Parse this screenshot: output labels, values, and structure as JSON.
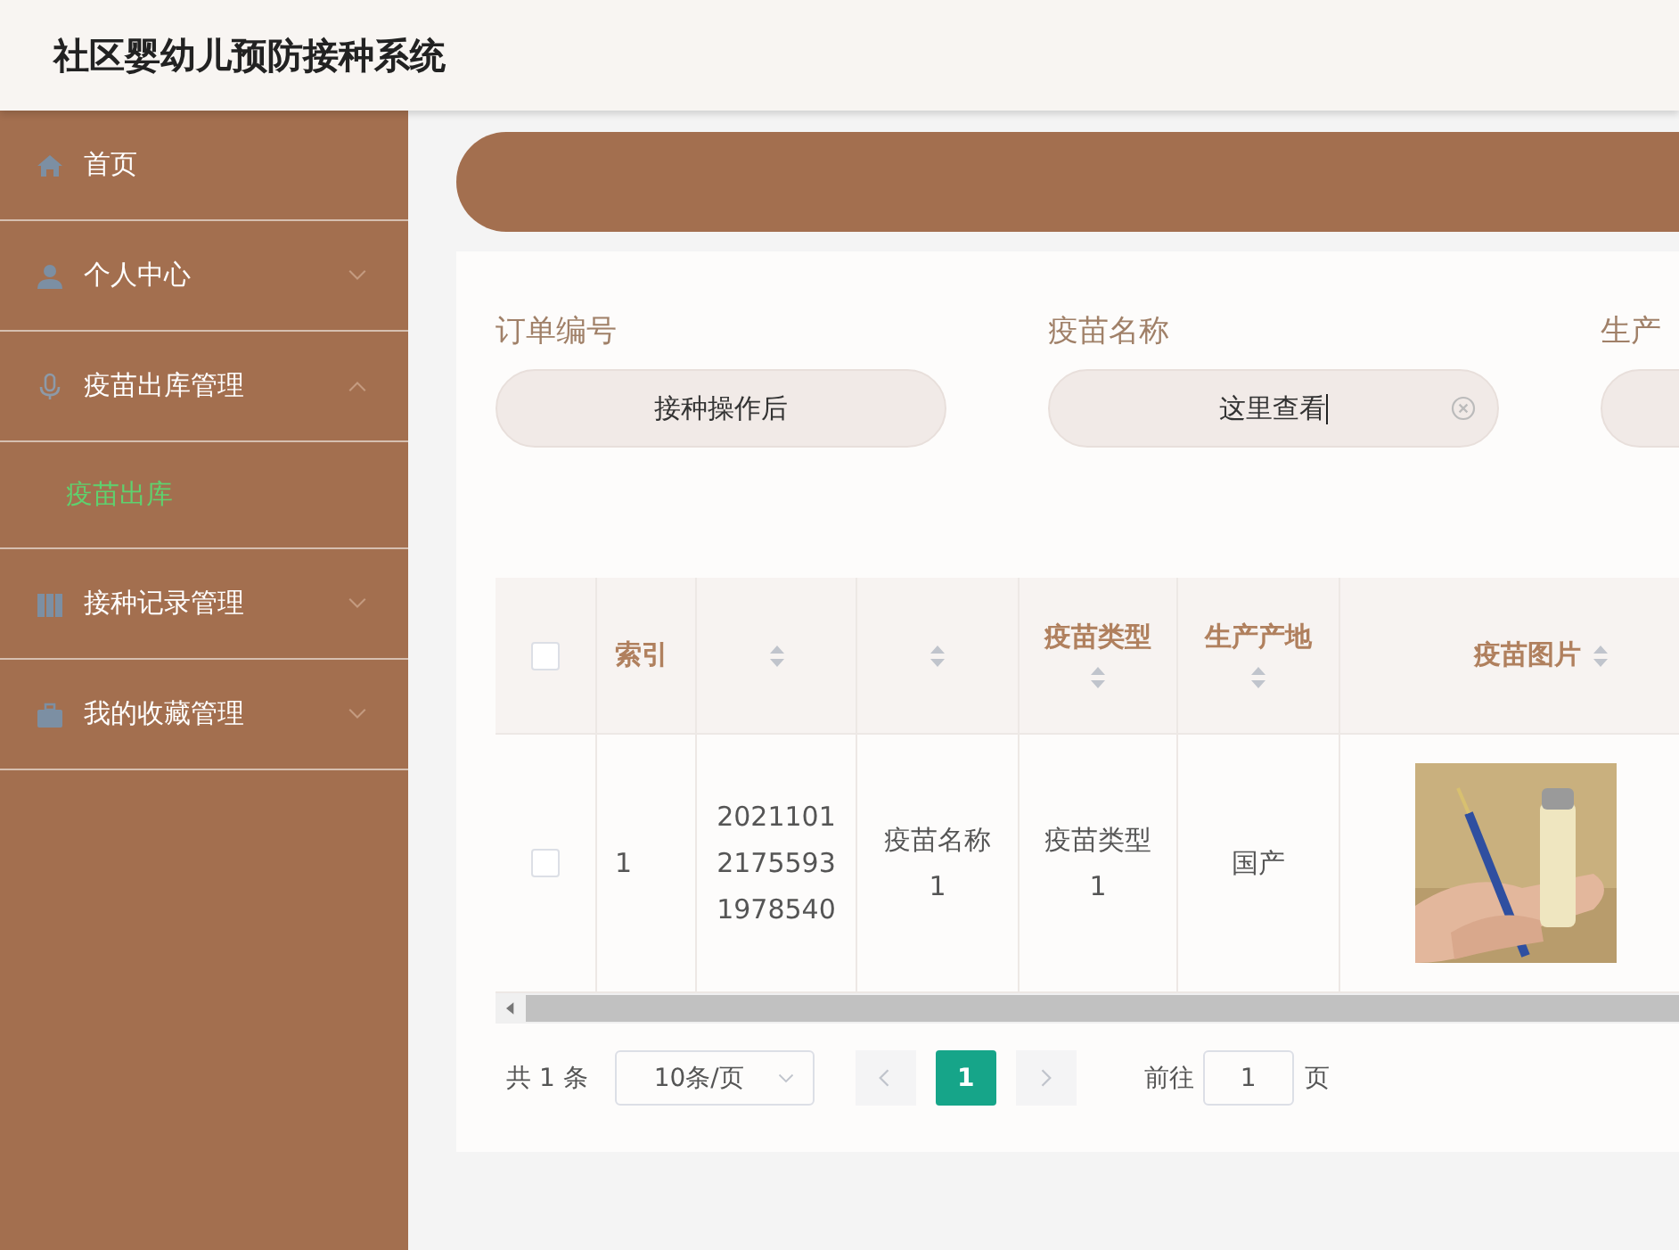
{
  "header": {
    "title": "社区婴幼儿预防接种系统"
  },
  "sidebar": {
    "items": [
      {
        "kind": "link",
        "label": "首页"
      },
      {
        "kind": "menu",
        "label": "个人中心",
        "expanded": false
      },
      {
        "kind": "menu",
        "label": "疫苗出库管理",
        "expanded": true,
        "children": [
          {
            "label": "疫苗出库",
            "selected": true
          }
        ]
      },
      {
        "kind": "menu",
        "label": "接种记录管理",
        "expanded": false
      },
      {
        "kind": "menu",
        "label": "我的收藏管理",
        "expanded": false
      }
    ]
  },
  "search": {
    "fields": [
      {
        "label": "订单编号",
        "value": "接种操作后",
        "clearable": false
      },
      {
        "label": "疫苗名称",
        "value": "这里查看",
        "clearable": true
      },
      {
        "label": "生产",
        "clearable": false
      }
    ]
  },
  "table": {
    "columns": [
      {
        "kind": "checkbox",
        "checked": false
      },
      {
        "kind": "text",
        "label": "索引",
        "sortable": false
      },
      {
        "kind": "text",
        "sortable": true
      },
      {
        "kind": "text",
        "sortable": true
      },
      {
        "kind": "text",
        "label": "疫苗类型",
        "sortable": true
      },
      {
        "kind": "text",
        "label": "生产产地",
        "sortable": true
      },
      {
        "kind": "picture",
        "label": "疫苗图片",
        "sortable": true
      }
    ],
    "rows": [
      {
        "cells": [
          {
            "kind": "checkbox",
            "checked": false
          },
          "1",
          "202110121755931978540",
          "疫苗名称1",
          "疫苗类型1",
          "国产",
          {
            "kind": "picture"
          }
        ]
      }
    ]
  },
  "pagination": {
    "total": "共 1 条",
    "page_size": "10条/页",
    "prev_disabled": true,
    "pages": [
      {
        "label": "1",
        "selected": true
      }
    ],
    "next_disabled": true,
    "goto_label": "前往",
    "goto_value": "1",
    "goto_unit": "页"
  }
}
